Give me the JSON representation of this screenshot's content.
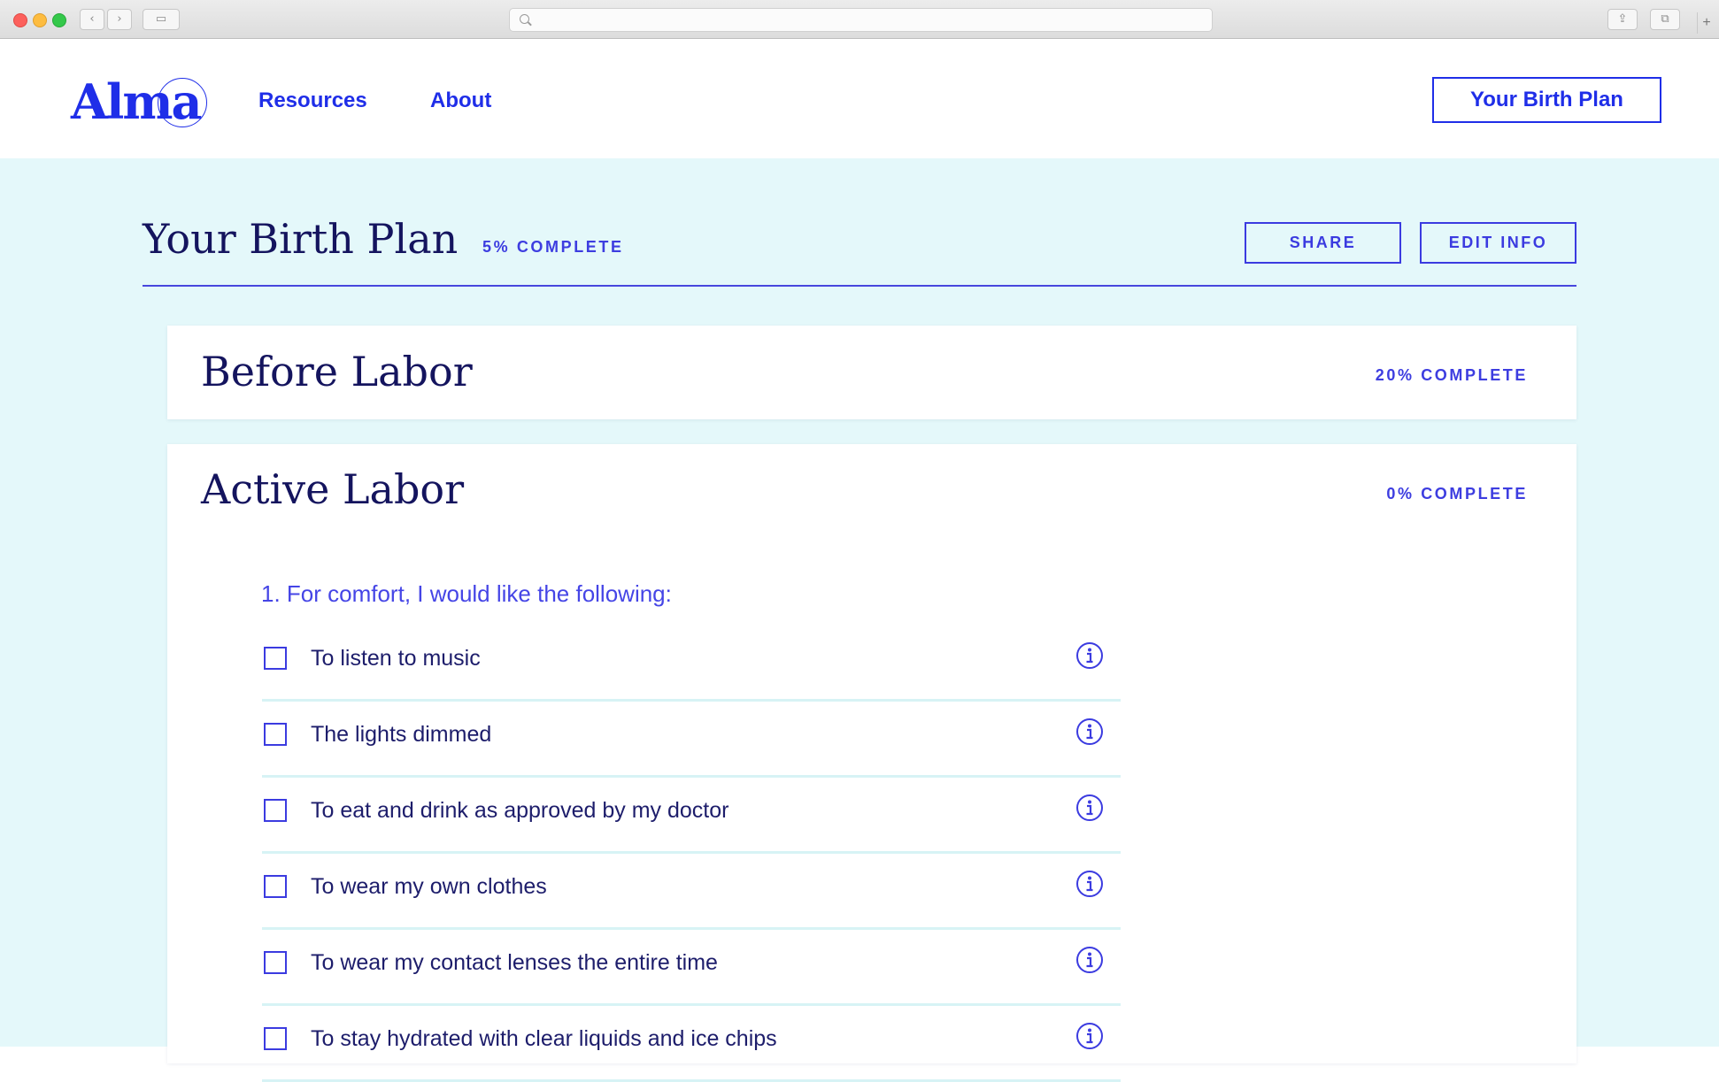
{
  "nav": {
    "logo": "Alma",
    "links": [
      "Resources",
      "About"
    ],
    "cta": "Your Birth Plan"
  },
  "plan": {
    "title": "Your Birth Plan",
    "progress": "5% COMPLETE",
    "actions": {
      "share": "SHARE",
      "edit": "EDIT INFO"
    }
  },
  "sections": [
    {
      "title": "Before Labor",
      "progress": "20% COMPLETE"
    },
    {
      "title": "Active Labor",
      "progress": "0% COMPLETE",
      "question": "1. For comfort, I would like the following:",
      "options": [
        {
          "label": "To listen to music",
          "checked": false
        },
        {
          "label": "The lights dimmed",
          "checked": false
        },
        {
          "label": "To eat and drink as approved by my doctor",
          "checked": false
        },
        {
          "label": "To wear my own clothes",
          "checked": false
        },
        {
          "label": "To wear my contact lenses the entire time",
          "checked": false
        },
        {
          "label": "To stay hydrated with clear liquids and ice chips",
          "checked": false
        }
      ]
    }
  ],
  "colors": {
    "brand_blue": "#1f2ee8",
    "accent_blue": "#3d3de0",
    "background_mint": "#e4f8fa",
    "heading_navy": "#14145e"
  },
  "icons": [
    "search-icon",
    "back-arrow-icon",
    "forward-arrow-icon",
    "sidebar-icon",
    "share-icon",
    "tabs-icon",
    "plus-icon",
    "info-icon"
  ]
}
